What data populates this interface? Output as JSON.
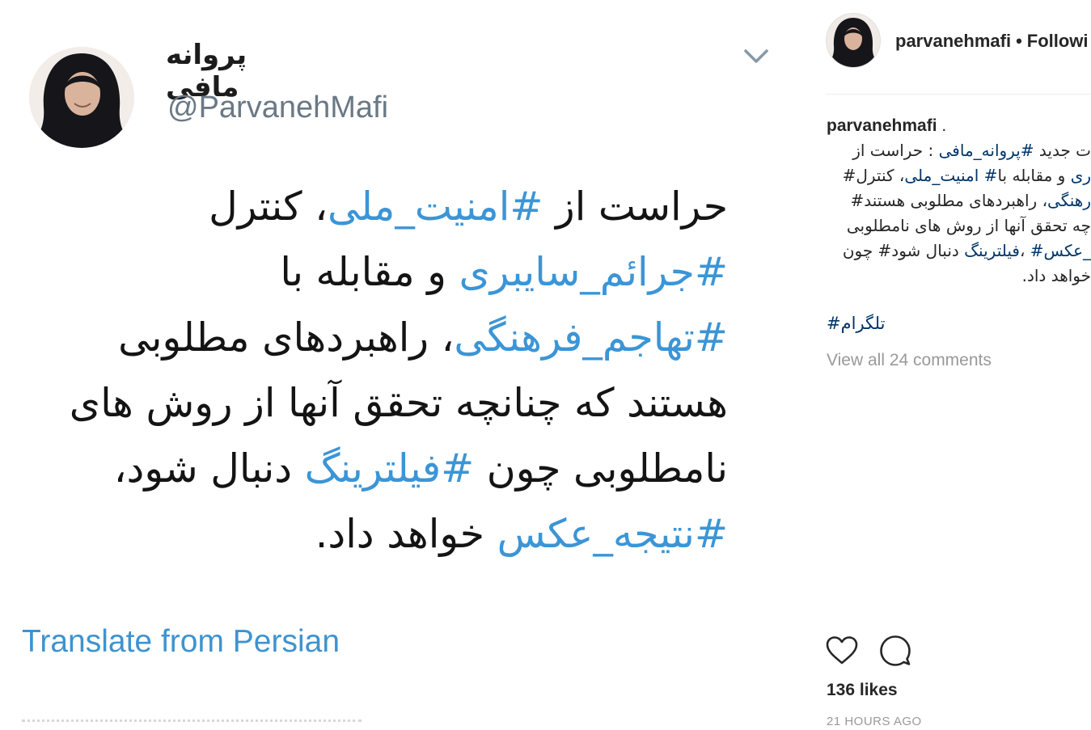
{
  "tweet": {
    "name": "پروانه مافی",
    "handle": "@ParvanehMafi",
    "body_lines": [
      [
        {
          "t": "حراست از ",
          "h": false
        },
        {
          "t": "#امنیت_ملی",
          "h": true
        },
        {
          "t": "، کنترل",
          "h": false
        }
      ],
      [
        {
          "t": "#جرائم_سایبری",
          "h": true
        },
        {
          "t": " و مقابله با",
          "h": false
        }
      ],
      [
        {
          "t": "#تهاجم_فرهنگی",
          "h": true
        },
        {
          "t": "، راهبردهای مطلوبی",
          "h": false
        }
      ],
      [
        {
          "t": "هستند که چنانچه تحقق آنها از روش های",
          "h": false
        }
      ],
      [
        {
          "t": "نامطلوبی چون ",
          "h": false
        },
        {
          "t": "#فیلترینگ",
          "h": true
        },
        {
          "t": " دنبال شود،",
          "h": false
        }
      ],
      [
        {
          "t": "#نتیجه_عکس",
          "h": true
        },
        {
          "t": " خواهد داد.",
          "h": false
        }
      ]
    ],
    "translate_label": "Translate from Persian",
    "colors": {
      "hashtag": "#3b95d6",
      "link": "#3e93cf",
      "handle": "#6a7985"
    }
  },
  "instagram": {
    "header_username": "parvanehmafi",
    "header_separator": "•",
    "follow_label": "Followi",
    "caption_username": "parvanehmafi",
    "caption_suffix": ".",
    "caption_lines": [
      [
        {
          "t": "ت جدید ",
          "h": false
        },
        {
          "t": "#پروانه_مافی",
          "h": true
        },
        {
          "t": " : حراست از",
          "h": false
        }
      ],
      [
        {
          "t": "ری",
          "h": true
        },
        {
          "t": " و مقابله با",
          "h": false
        },
        {
          "t": "# امنیت_ملی",
          "h": true
        },
        {
          "t": "، کنترل#",
          "h": false
        }
      ],
      [
        {
          "t": "رهنگی",
          "h": true
        },
        {
          "t": "، راهبردهای مطلوبی هستند#",
          "h": false
        }
      ],
      [
        {
          "t": "چه تحقق آنها از روش های نامطلوبی",
          "h": false
        }
      ],
      [
        {
          "t": "_عکس#",
          "h": true
        },
        {
          "t": " ،",
          "h": false
        },
        {
          "t": "فیلترینگ",
          "h": true
        },
        {
          "t": " دنبال شود# چون",
          "h": false
        }
      ],
      [
        {
          "t": "خواهد داد.",
          "h": false
        }
      ]
    ],
    "hashtag_line": "#تلگرام",
    "view_all_comments": "View all 24 comments",
    "likes": "136 likes",
    "timestamp": "21 HOURS AGO",
    "icons": [
      "heart-icon",
      "comment-icon",
      "chevron-down-icon"
    ],
    "colors": {
      "hashtag": "#003569",
      "muted": "#999999"
    }
  }
}
